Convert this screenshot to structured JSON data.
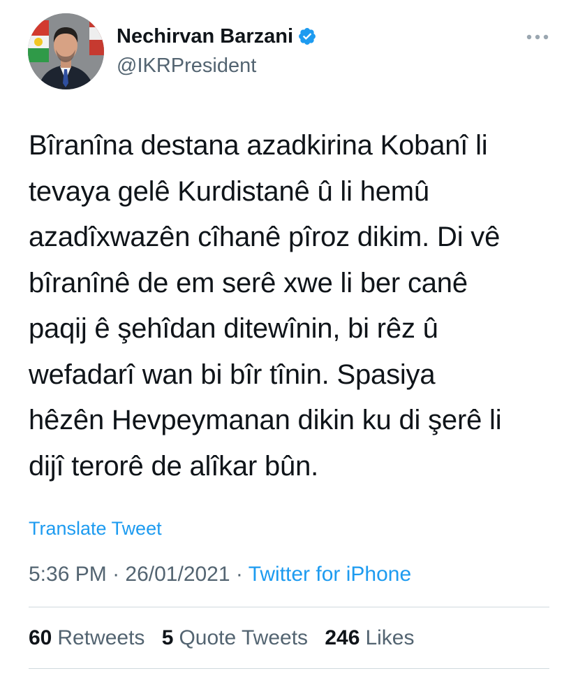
{
  "author": {
    "name": "Nechirvan Barzani",
    "handle": "@IKRPresident",
    "verified": true,
    "avatar_icon": "portrait-avatar"
  },
  "more_icon": "more-horizontal-icon",
  "tweet": {
    "lines": [
      "Bîranîna destana azadkirina Kobanî li",
      "tevaya gelê Kurdistanê û li hemû",
      "azadîxwazên cîhanê pîroz dikim. Di vê",
      "bîranînê de em serê xwe li ber canê",
      "paqij ê şehîdan ditewînin, bi rêz û",
      "wefadarî wan bi bîr tînin. Spasiya",
      "hêzên Hevpeymanan dikin ku di şerê li",
      "dijî terorê de alîkar bûn."
    ]
  },
  "translate_label": "Translate Tweet",
  "meta": {
    "time": "5:36 PM",
    "separator1": " · ",
    "date": "26/01/2021",
    "separator2": " · ",
    "source": "Twitter for iPhone"
  },
  "stats": {
    "retweets_count": "60",
    "retweets_label": "Retweets",
    "quotes_count": "5",
    "quotes_label": "Quote Tweets",
    "likes_count": "246",
    "likes_label": "Likes"
  },
  "colors": {
    "accent": "#1d9bf0",
    "text_primary": "#0f1419",
    "text_secondary": "#536471",
    "divider": "#cfd9de"
  }
}
